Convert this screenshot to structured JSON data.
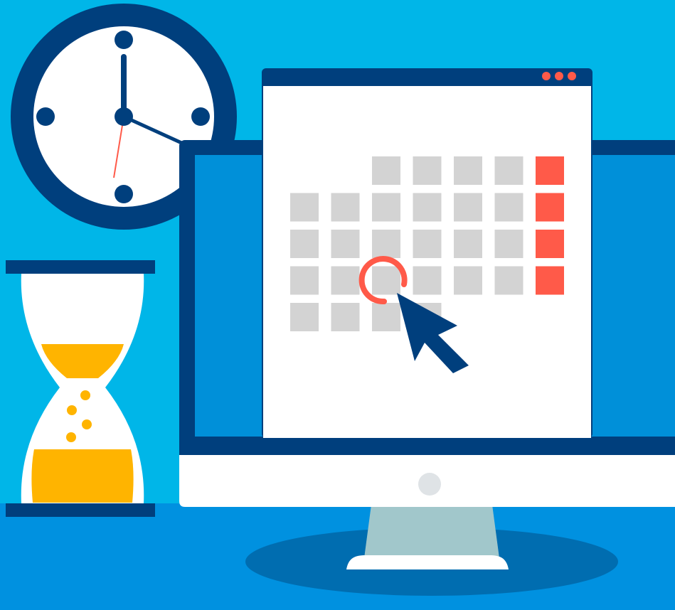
{
  "colors": {
    "sky": "#00b6e8",
    "floor": "#0091e0",
    "shadow": "#006db0",
    "navy": "#003f7d",
    "white": "#ffffff",
    "cell": "#d3d3d3",
    "accent": "#ff5a49",
    "sand": "#ffb400",
    "stand": "#a1c7cb",
    "screen_blue": "#0090d9",
    "power": "#dfe3e6"
  },
  "calendar": {
    "weeks": [
      [
        0,
        0,
        1,
        1,
        1,
        1,
        2
      ],
      [
        1,
        1,
        1,
        1,
        1,
        1,
        2
      ],
      [
        1,
        1,
        1,
        1,
        1,
        1,
        2
      ],
      [
        1,
        1,
        1,
        1,
        1,
        1,
        2
      ],
      [
        1,
        1,
        1,
        1,
        0,
        0,
        0
      ]
    ],
    "selected_week": 3,
    "selected_day": 2
  },
  "clock": {
    "hour_hand": "12",
    "minute_hand": "20"
  },
  "icons": [
    "clock-icon",
    "hourglass-icon",
    "monitor-icon",
    "calendar-icon",
    "cursor-icon"
  ]
}
